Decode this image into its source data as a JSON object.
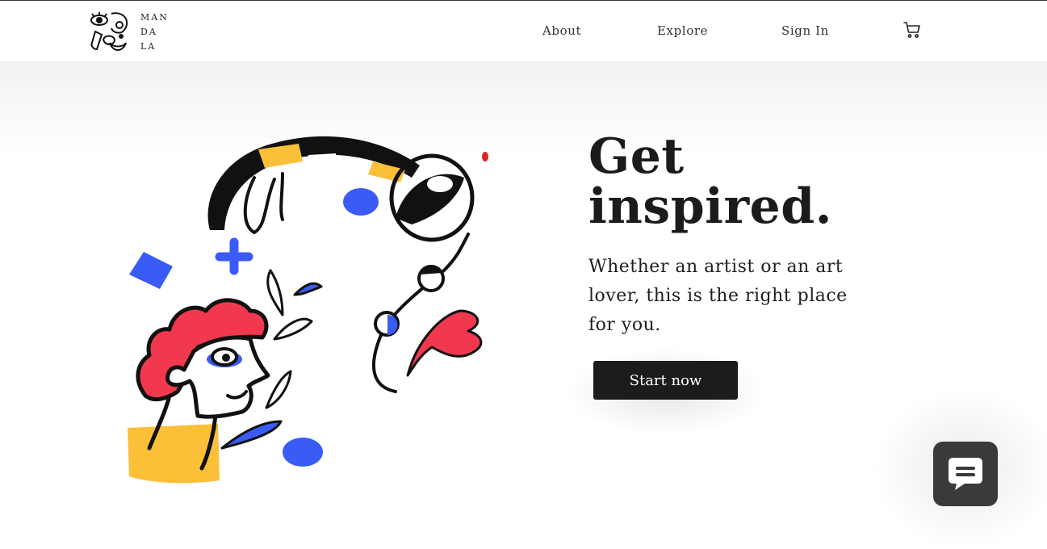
{
  "header": {
    "logo_lines": [
      "MAN",
      "DA",
      "LA"
    ],
    "nav": [
      {
        "label": "About"
      },
      {
        "label": "Explore"
      },
      {
        "label": "Sign In"
      }
    ],
    "cart_icon": "shopping-cart-icon"
  },
  "hero": {
    "title_line1": "Get",
    "title_line2": "inspired.",
    "subtitle": "Whether an artist or an art lover, this is the right place for you.",
    "cta_label": "Start now",
    "illustration_icon": "artist-illustration"
  },
  "chat_widget": {
    "icon": "chat-bubble-icon"
  },
  "colors": {
    "dark": "#1c1c1c",
    "blue": "#3b5bf7",
    "red": "#f2384f",
    "yellow": "#fbbf38",
    "chat_bg": "#3a3a3a"
  }
}
